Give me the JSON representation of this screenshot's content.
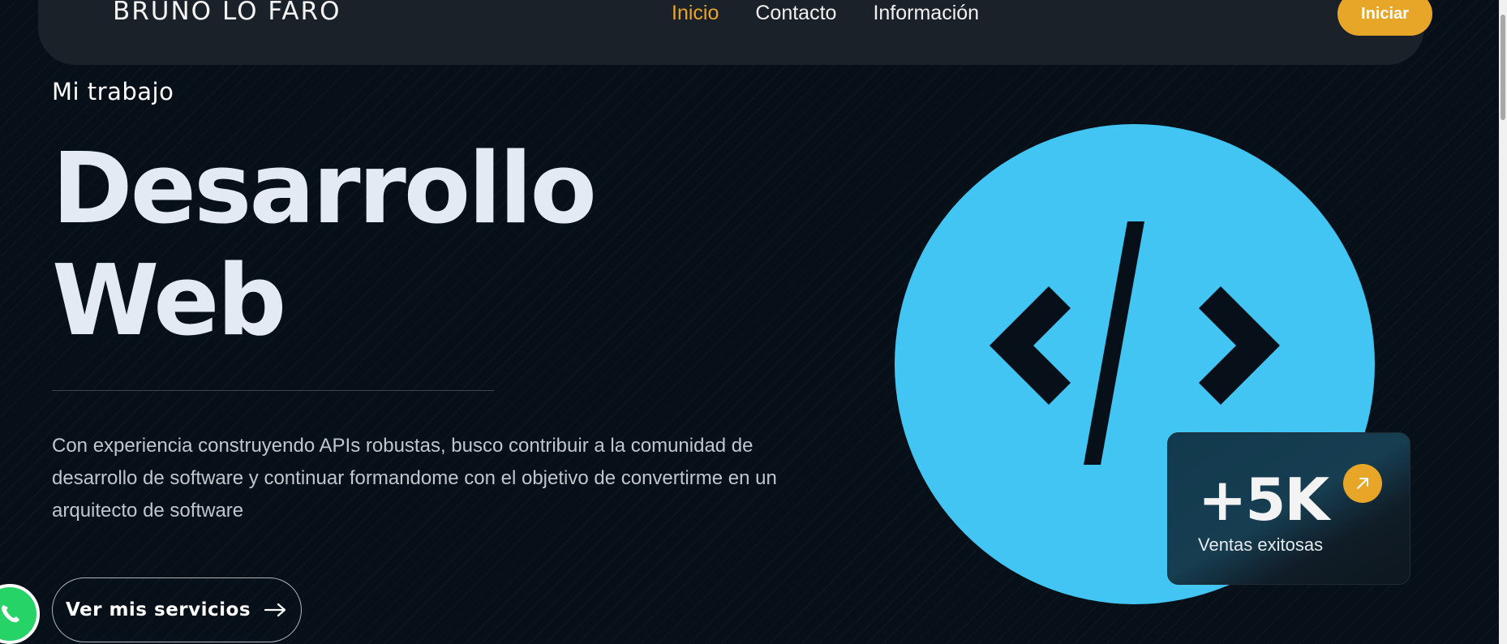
{
  "nav": {
    "brand": "BRUNO LO FARO",
    "links": [
      "Inicio",
      "Contacto",
      "Información"
    ],
    "active_index": 0,
    "cta_label": "Iniciar"
  },
  "hero": {
    "subtitle": "Mi trabajo",
    "headline_line1": "Desarrollo",
    "headline_line2": "Web",
    "description": "Con experiencia construyendo APIs robustas, busco contribuir a la comunidad de desarrollo de software y continuar formandome con el objetivo de convertirme en un arquitecto de software",
    "cta_label": "Ver mis servicios",
    "icon": "code-icon"
  },
  "stat": {
    "value": "+5K",
    "label": "Ventas exitosas",
    "icon": "arrow-up-right-icon"
  },
  "floating": {
    "icon": "whatsapp-icon"
  },
  "colors": {
    "accent": "#e8a628",
    "background": "#071018",
    "circle": "#42c5f2",
    "navbar": "#1a2128"
  }
}
